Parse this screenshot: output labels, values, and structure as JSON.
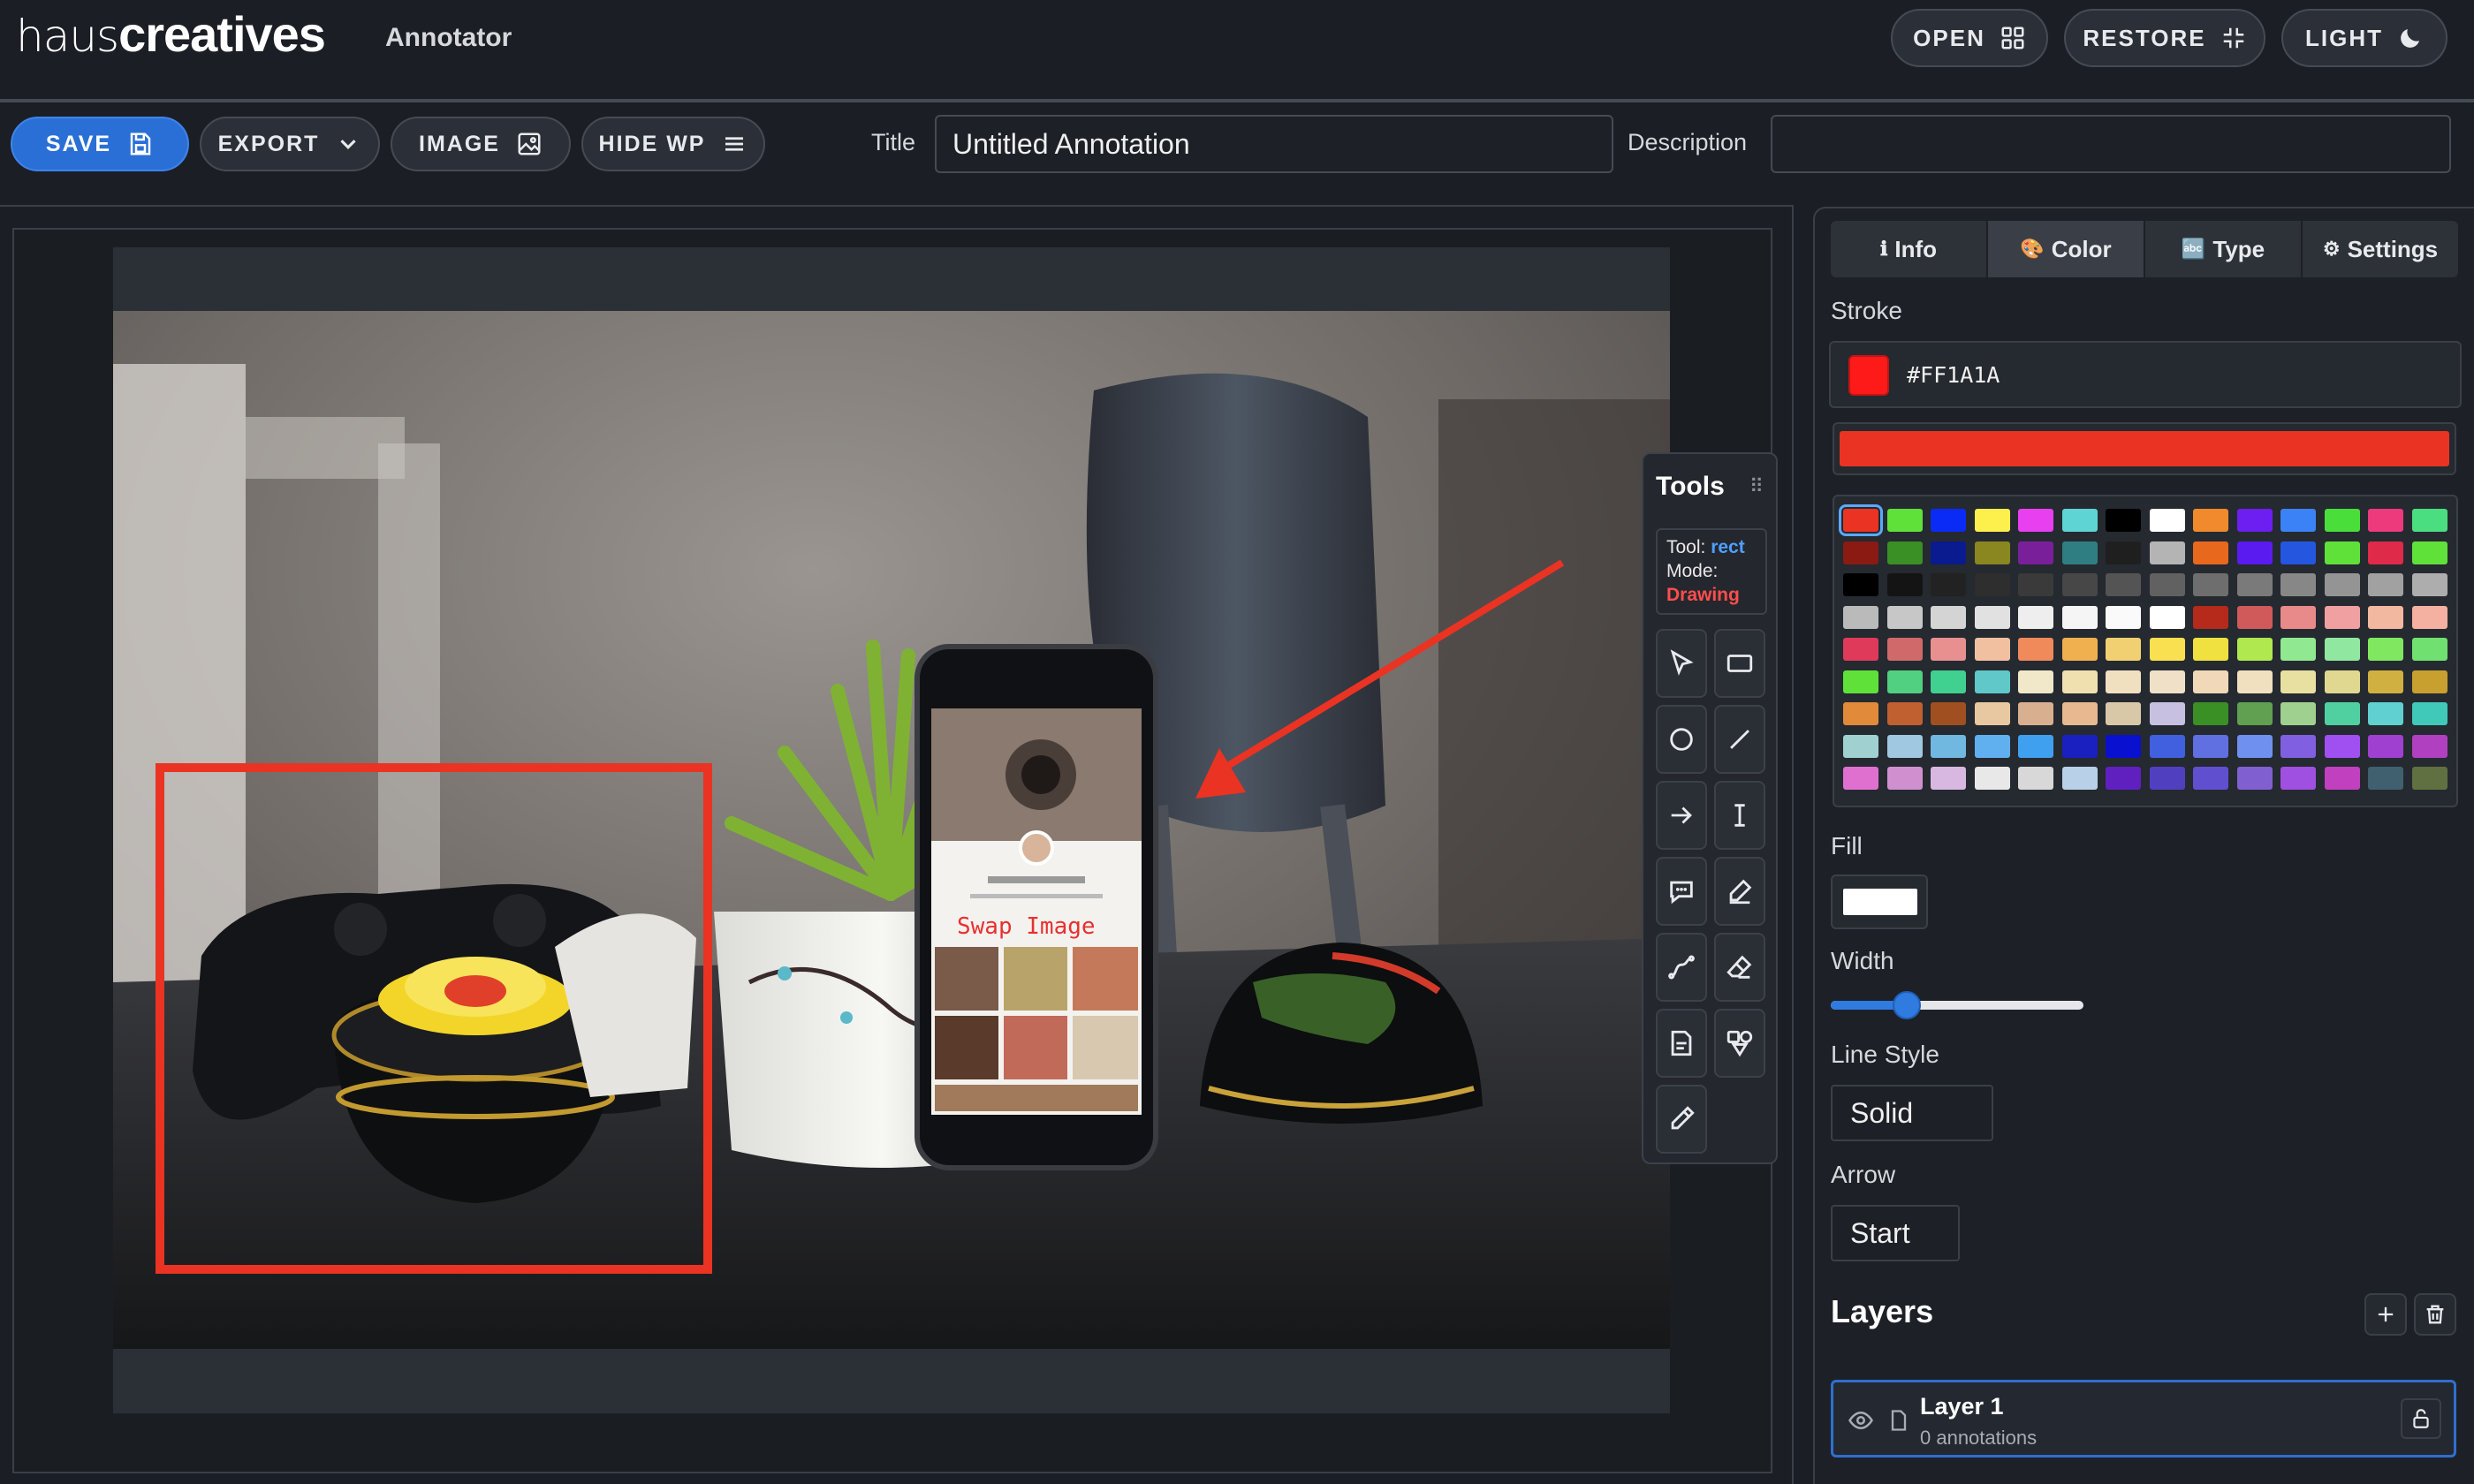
{
  "header": {
    "logo_light": "haus",
    "logo_bold": "creatives",
    "app_name": "Annotator",
    "buttons": {
      "open": "OPEN",
      "restore": "RESTORE",
      "light": "LIGHT"
    }
  },
  "toolbar": {
    "save": "SAVE",
    "export": "EXPORT",
    "image": "IMAGE",
    "hide_wp": "HIDE WP",
    "title_label": "Title",
    "title_value": "Untitled Annotation",
    "description_label": "Description",
    "description_value": ""
  },
  "canvas": {
    "phone_overlay_text": "Swap  Image",
    "annotations": [
      {
        "type": "rect",
        "color": "#ea3323"
      },
      {
        "type": "arrow",
        "color": "#ea3323"
      }
    ]
  },
  "tools": {
    "title": "Tools",
    "tool_label": "Tool:",
    "tool_value": "rect",
    "mode_label": "Mode:",
    "mode_value": "Drawing",
    "items": [
      "select",
      "rectangle",
      "ellipse",
      "line",
      "arrow",
      "text",
      "callout",
      "pen",
      "curve",
      "eraser",
      "note",
      "shapes",
      "eyedropper"
    ]
  },
  "panel": {
    "tabs": [
      {
        "icon": "ℹ",
        "label": "Info"
      },
      {
        "icon": "🎨",
        "label": "Color"
      },
      {
        "icon": "🔤",
        "label": "Type"
      },
      {
        "icon": "⚙",
        "label": "Settings"
      }
    ],
    "active_tab": "Color",
    "stroke_label": "Stroke",
    "stroke_hex": "#FF1A1A",
    "stroke_color": "#ff1a1a",
    "fill_label": "Fill",
    "fill_color": "#ffffff",
    "width_label": "Width",
    "width_value": 0.3,
    "line_style_label": "Line Style",
    "line_style_value": "Solid",
    "arrow_label": "Arrow",
    "arrow_value": "Start",
    "palette": [
      [
        "#ea3323",
        "#5fe13a",
        "#0a2bf5",
        "#fdf04d",
        "#e83ff1",
        "#5fd4d4",
        "#000000",
        "#ffffff",
        "#f08a2c",
        "#6c1ff0",
        "#3b82f6",
        "#4ade3a",
        "#ec3a7c",
        "#4ade80"
      ],
      [
        "#8b1a12",
        "#3a8f25",
        "#0a1a8f",
        "#8a8620",
        "#7a1f9a",
        "#2f7f82",
        "#1f1f1f",
        "#b4b4b4",
        "#e8681e",
        "#5a1bf0",
        "#2456e0",
        "#5fe13a",
        "#e02a4a",
        "#5fe13a"
      ],
      [
        "#000000",
        "#141414",
        "#222222",
        "#2e2e2e",
        "#3a3a3a",
        "#474747",
        "#545454",
        "#616161",
        "#6e6e6e",
        "#7a7a7a",
        "#878787",
        "#949494",
        "#a1a1a1",
        "#adadad"
      ],
      [
        "#bababa",
        "#c7c7c7",
        "#d4d4d4",
        "#e1e1e1",
        "#eeeeee",
        "#f5f5f5",
        "#fafafa",
        "#ffffff",
        "#b52a1a",
        "#d05a5a",
        "#e88a8a",
        "#f0a0a0",
        "#f2b8a0",
        "#f4b0a0"
      ],
      [
        "#e03a5a",
        "#d06a6a",
        "#e89090",
        "#f0c0a0",
        "#f08a5a",
        "#f0b050",
        "#f0d070",
        "#f8e050",
        "#f0e040",
        "#b0e850",
        "#90e890",
        "#90e8a0",
        "#80e860",
        "#70e070"
      ],
      [
        "#5fe13a",
        "#50d080",
        "#40d090",
        "#60c8c8",
        "#f0e8c8",
        "#f0e0b0",
        "#f0e0c0",
        "#f0e0c8",
        "#f0d8b8",
        "#f0e0c0",
        "#e8e0a0",
        "#e0d890",
        "#d0b040",
        "#c8a030"
      ],
      [
        "#e08a3a",
        "#c06030",
        "#a05020",
        "#e8c8a0",
        "#d8b090",
        "#e8b890",
        "#d8c8a8",
        "#c8c0e0",
        "#3a8f25",
        "#60a050",
        "#a0d090",
        "#50d0a0",
        "#60d0d0",
        "#40c8b8"
      ],
      [
        "#a0d0d0",
        "#a0c8e0",
        "#70b8e0",
        "#60b0f0",
        "#40a0f0",
        "#1a20c0",
        "#0a10d0",
        "#4060e0",
        "#6070e0",
        "#7090f0",
        "#8060e0",
        "#a050f0",
        "#a040d0",
        "#b040c0"
      ],
      [
        "#e070d0",
        "#d090d0",
        "#d8b8e0",
        "#e8e8e8",
        "#d8d8d8",
        "#b8d0e8",
        "#6020c0",
        "#5040c0",
        "#6050d0",
        "#8060d0",
        "#a050e0",
        "#c040c0",
        "#406070",
        "#607040"
      ]
    ],
    "layers_title": "Layers",
    "layers": [
      {
        "name": "Layer 1",
        "count": "0 annotations"
      }
    ]
  }
}
